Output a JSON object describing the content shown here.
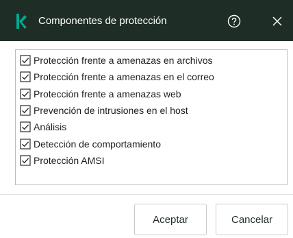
{
  "window": {
    "title": "Componentes de protección",
    "logo_icon": "kaspersky-k-icon",
    "help_icon": "help-icon",
    "close_icon": "close-icon",
    "titlebar_color": "#1f2d27",
    "logo_color": "#00a88e"
  },
  "components": [
    {
      "label": "Protección frente a amenazas en archivos",
      "checked": true
    },
    {
      "label": "Protección frente a amenazas en el correo",
      "checked": true
    },
    {
      "label": "Protección frente a amenazas web",
      "checked": true
    },
    {
      "label": "Prevención de intrusiones en el host",
      "checked": true
    },
    {
      "label": "Análisis",
      "checked": true
    },
    {
      "label": "Detección de comportamiento",
      "checked": true
    },
    {
      "label": "Protección AMSI",
      "checked": true
    }
  ],
  "buttons": {
    "ok_label": "Aceptar",
    "cancel_label": "Cancelar"
  }
}
